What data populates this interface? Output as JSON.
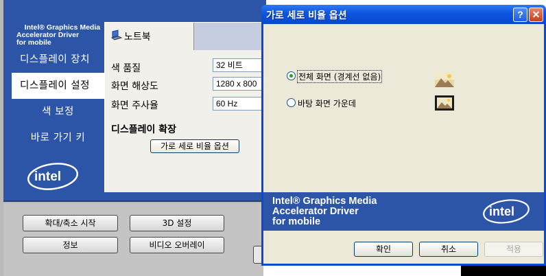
{
  "main_window": {
    "brand": {
      "lines": "Intel® Graphics Media\nAccelerator Driver\nfor mobile"
    },
    "nav": {
      "items": [
        {
          "label": "디스플레이 장치"
        },
        {
          "label": "디스플레이 설정"
        },
        {
          "label": "색 보정"
        },
        {
          "label": "바로 가기 키"
        }
      ]
    },
    "logo_text": "intel",
    "tab": {
      "label": "노트북"
    },
    "fields": {
      "color_quality": {
        "label": "색 품질",
        "value": "32 비트"
      },
      "resolution": {
        "label": "화면 해상도",
        "value": "1280 x 800"
      },
      "refresh_rate": {
        "label": "화면 주사율",
        "value": "60 Hz"
      }
    },
    "display_expand": {
      "title": "디스플레이 확장",
      "button": "가로 세로 비율 옵션"
    },
    "buttons": {
      "zoom": "확대/축소 시작",
      "settings_3d": "3D 설정",
      "info": "정보",
      "video_overlay": "비디오 오버레이"
    }
  },
  "dialog": {
    "title": "가로 세로 비율 옵션",
    "help_glyph": "?",
    "close_glyph": "✕",
    "options": [
      {
        "label": "전체 화면 (경계선 없음)",
        "selected": true
      },
      {
        "label": "바탕 화면 가운데",
        "selected": false
      }
    ],
    "banner": {
      "text": "Intel® Graphics Media\nAccelerator Driver\nfor mobile",
      "logo_text": "intel"
    },
    "buttons": {
      "ok": "확인",
      "cancel": "취소",
      "apply": "적용"
    }
  },
  "colors": {
    "intel_blue": "#2c55a8",
    "xp_title_blue": "#0a48d6",
    "dialog_face": "#ece9d8",
    "radio_dot": "#21a121"
  }
}
